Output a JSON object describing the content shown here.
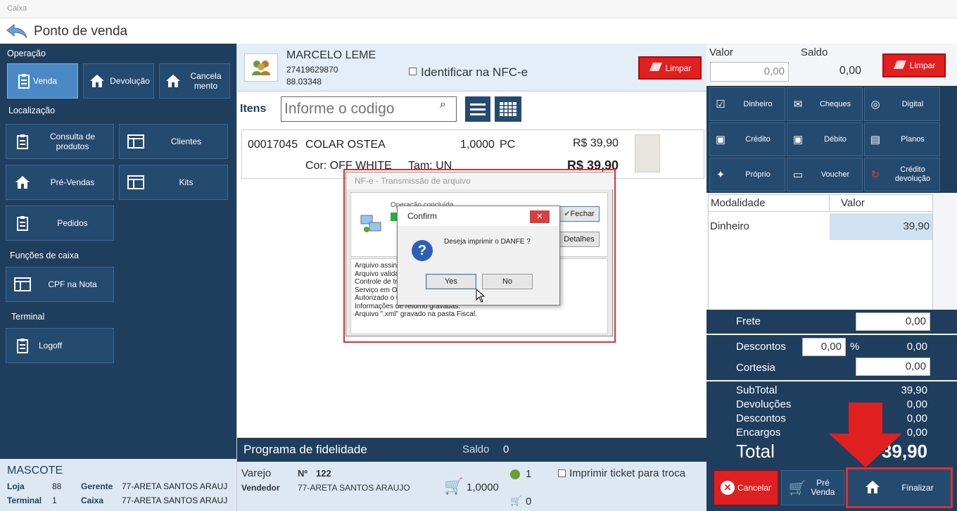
{
  "window": {
    "caption": "Caixa",
    "title": "Ponto de venda"
  },
  "left": {
    "sections": {
      "operacao": "Operação",
      "localizacao": "Localização",
      "funcoes": "Funções de caixa",
      "terminal": "Terminal"
    },
    "operacao": {
      "venda": "Venda",
      "devolucao": "Devolução",
      "cancelamento": "Cancela mento"
    },
    "localizacao": {
      "consulta": "Consulta de produtos",
      "clientes": "Clientes",
      "prevendas": "Pré-Vendas",
      "kits": "Kits",
      "pedidos": "Pedidos"
    },
    "funcoes": {
      "cpf": "CPF na Nota"
    },
    "terminal": {
      "logoff": "Logoff"
    }
  },
  "status": {
    "name": "MASCOTE",
    "loja_label": "Loja",
    "loja": "88",
    "gerente_label": "Gerente",
    "gerente": "77-ARETA  SANTOS ARAUJ",
    "terminal_label": "Terminal",
    "terminal": "1",
    "caixa_label": "Caixa",
    "caixa": "77-ARETA  SANTOS ARAUJ"
  },
  "customer": {
    "name": "MARCELO LEME",
    "doc": "27419629870",
    "code": "88.03348",
    "identify": "Identificar na NFC-e",
    "clear": "Limpar"
  },
  "items": {
    "label": "Itens",
    "placeholder": "Informe o codigo"
  },
  "item": {
    "code": "00017045",
    "desc": "COLAR OSTEA",
    "qty": "1,0000",
    "unit": "PC",
    "price": "R$ 39,90",
    "cor": "Cor: OFF WHITE",
    "tam": "Tam: UN",
    "total": "R$ 39,90"
  },
  "fidelidade": {
    "title": "Programa de fidelidade",
    "saldo_label": "Saldo",
    "saldo": "0"
  },
  "bottom": {
    "varejo": "Varejo",
    "numero_label": "Nº",
    "numero": "122",
    "vendedor_label": "Vendedor",
    "vendedor": "77-ARETA  SANTOS ARAUJO",
    "qty": "1,0000",
    "ok_count": "1",
    "cart_count": "0",
    "print_ticket": "Imprimir ticket para troca"
  },
  "payment": {
    "valor_label": "Valor",
    "saldo_label": "Saldo",
    "valor": "0,00",
    "saldo": "0,00",
    "clear": "Limpar",
    "methods": [
      "Dinheiro",
      "Cheques",
      "Digital",
      "Crédito",
      "Débito",
      "Planos",
      "Próprio",
      "Voucher",
      "Crédito devolução"
    ],
    "table_headers": [
      "Modalidade",
      "Valor"
    ],
    "table_rows": [
      {
        "mod": "Dinheiro",
        "valor": "39,90"
      }
    ]
  },
  "totals": {
    "frete_label": "Frete",
    "frete": "0,00",
    "descontos_label": "Descontos",
    "desc_pct": "0,00",
    "pct_sign": "%",
    "desc_val": "0,00",
    "cortesia_label": "Cortesia",
    "cortesia": "0,00",
    "subtotal_label": "SubTotal",
    "subtotal": "39,90",
    "devolucoes_label": "Devoluções",
    "devolucoes": "0,00",
    "descontos2_label": "Descontos",
    "descontos2": "0,00",
    "encargos_label": "Encargos",
    "encargos": "0,00",
    "total_label": "Total",
    "total": "39,90"
  },
  "actions": {
    "cancelar": "Cancelar",
    "prevenda": "Pré Venda",
    "finalizar": "Finalizar"
  },
  "nfe": {
    "title": "NF-e - Transmissão de arquivo",
    "op": "Operação concluída",
    "fechar": "Fechar",
    "detalhes": "Detalhes",
    "log": [
      "Arquivo assinado.",
      "Arquivo validado.",
      "Controle de transmissão.",
      "Serviço em Operação.",
      "Autorizado o uso da NF-e.",
      "Informações de retorno gravadas.",
      "Arquivo \".xml\" gravado na pasta Fiscal."
    ]
  },
  "confirm": {
    "title": "Confirm",
    "message": "Deseja imprimir o DANFE ?",
    "yes": "Yes",
    "no": "No"
  },
  "colors": {
    "navy": "#1f3e5e",
    "tile": "#254a70",
    "red": "#e02020",
    "highlight": "#e03030"
  }
}
